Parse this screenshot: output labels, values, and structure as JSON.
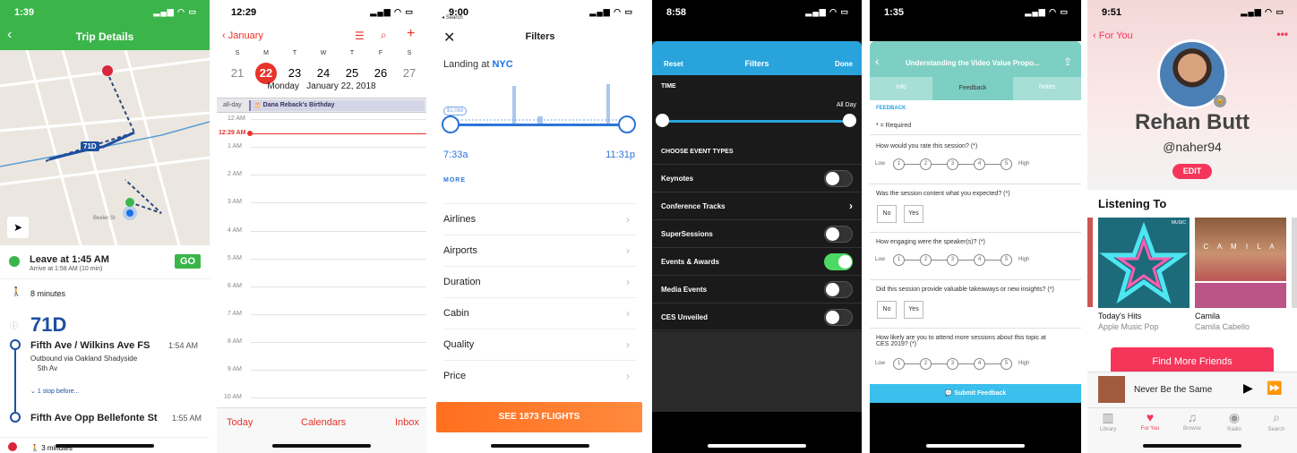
{
  "p1": {
    "status_time": "1:39",
    "title": "Trip Details",
    "route_label": "71D",
    "leave": "Leave at 1:45 AM",
    "arrive": "Arrive at 1:58 AM (10 min)",
    "go": "GO",
    "walk1": "8 minutes",
    "route_big": "71D",
    "stop1": "Fifth Ave / Wilkins Ave FS",
    "stop1_time": "1:54 AM",
    "outbound": "Outbound via Oakland Shadyside",
    "outbound2": "5th Av",
    "stops_before": "1 stop before...",
    "stop2": "Fifth Ave Opp Bellefonte St",
    "stop2_time": "1:55 AM",
    "walk2": "3 minutes",
    "map_streets": [
      "Beeler St",
      "Fifth Ave",
      "Wilkins Ave"
    ]
  },
  "p2": {
    "status_time": "12:29",
    "back": "January",
    "dows": [
      "S",
      "M",
      "T",
      "W",
      "T",
      "F",
      "S"
    ],
    "days": [
      "21",
      "22",
      "23",
      "24",
      "25",
      "26",
      "27"
    ],
    "date_line": "Monday   January 22, 2018",
    "allday": "all-day",
    "event": "Dana Reback's Birthday",
    "now": "12:29 AM",
    "hours": [
      "12 AM",
      "1 AM",
      "2 AM",
      "3 AM",
      "4 AM",
      "5 AM",
      "6 AM",
      "7 AM",
      "8 AM",
      "9 AM",
      "10 AM"
    ],
    "tab_today": "Today",
    "tab_cal": "Calendars",
    "tab_inbox": "Inbox"
  },
  "p3": {
    "status_time": "9:00",
    "status_back": "Search",
    "title": "Filters",
    "landing": "Landing at",
    "landing_city": "NYC",
    "price_tag": "$1,068",
    "t_start": "7:33a",
    "t_end": "11:31p",
    "more": "MORE",
    "rows": [
      "Airlines",
      "Airports",
      "Duration",
      "Cabin",
      "Quality",
      "Price"
    ],
    "cta": "SEE 1873 FLIGHTS"
  },
  "p4": {
    "status_time": "8:58",
    "reset": "Reset",
    "title": "Filters",
    "done": "Done",
    "time": "TIME",
    "allday": "All Day",
    "choose": "CHOOSE EVENT TYPES",
    "events": [
      {
        "label": "Keynotes",
        "kind": "toggle",
        "on": false
      },
      {
        "label": "Conference Tracks",
        "kind": "chevron"
      },
      {
        "label": "SuperSessions",
        "kind": "toggle",
        "on": false
      },
      {
        "label": "Events & Awards",
        "kind": "toggle",
        "on": true
      },
      {
        "label": "Media Events",
        "kind": "toggle",
        "on": false
      },
      {
        "label": "CES Unveiled",
        "kind": "toggle",
        "on": false
      }
    ],
    "accent": "#29a3dc"
  },
  "p5": {
    "status_time": "1:35",
    "title": "Understanding the Video Value Propo...",
    "tabs": [
      "Info",
      "Feedback",
      "Notes"
    ],
    "feedback_head": "FEEDBACK",
    "required": "* = Required",
    "q1": "How would you rate this session? (*)",
    "q2": "Was the session content what you expected? (*)",
    "q3": "How engaging were the speaker(s)? (*)",
    "q4": "Did this session provide valuable takeaways or new insights? (*)",
    "q5": "How likely are you to attend more sessions about this topic at CES 2019? (*)",
    "low": "Low",
    "high": "High",
    "nums": [
      "1",
      "2",
      "3",
      "4",
      "5"
    ],
    "no": "No",
    "yes": "Yes",
    "submit": "Submit Feedback",
    "accent": "#7ecfc3"
  },
  "p6": {
    "status_time": "9:51",
    "back": "For You",
    "name": "Rehan Butt",
    "handle": "@naher94",
    "edit": "EDIT",
    "listening": "Listening To",
    "albums": [
      {
        "title": "Today's Hits",
        "sub": "Apple Music Pop",
        "badge": "MUSIC"
      },
      {
        "title": "Camila",
        "sub": "Camila Cabello",
        "art": "C A M I L A"
      }
    ],
    "find": "Find More Friends",
    "now_playing": "Never Be the Same",
    "tabs": [
      "Library",
      "For You",
      "Browse",
      "Radio",
      "Search"
    ],
    "accent": "#f5355a"
  }
}
